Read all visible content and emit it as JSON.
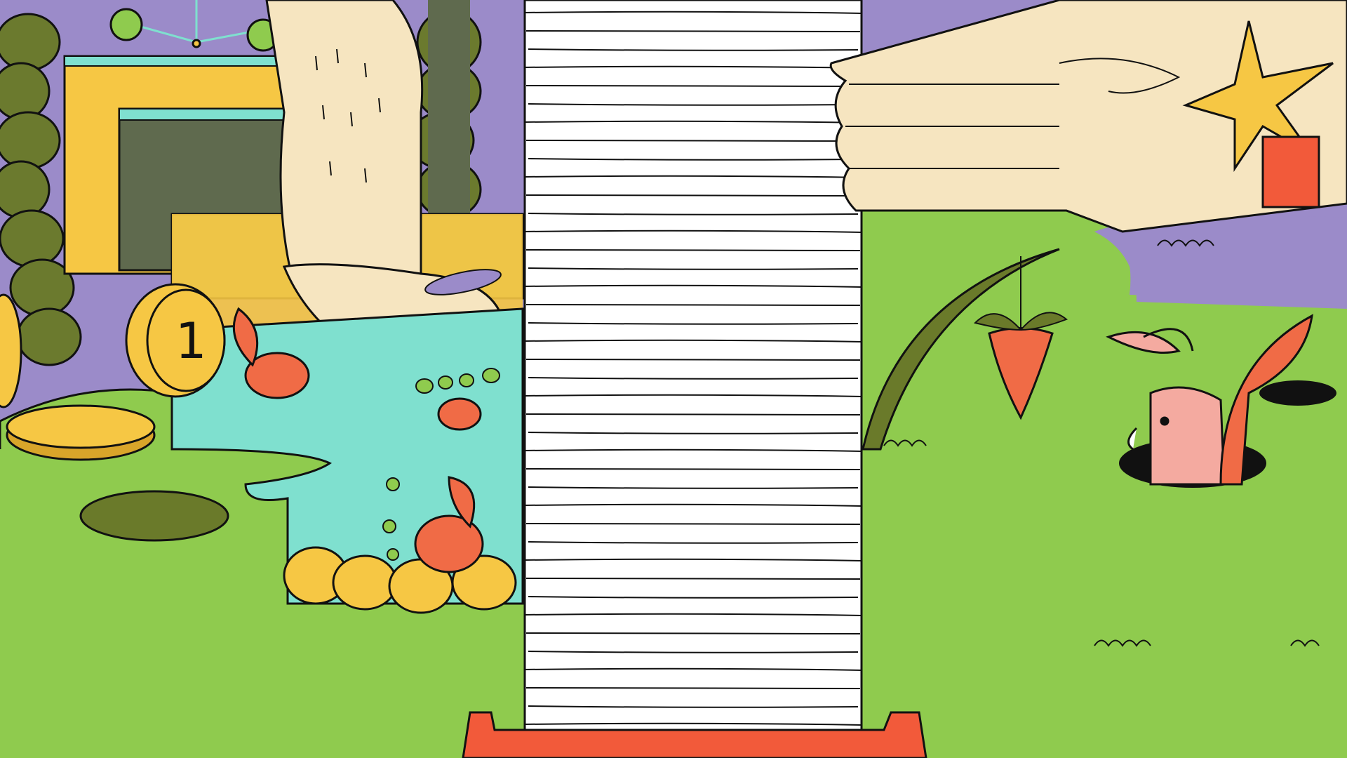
{
  "illustration": {
    "coin_glyph": "1",
    "colors": {
      "sky": "#9b8bc9",
      "grass": "#8fcb4e",
      "grass_dark": "#6a7a2a",
      "bush": "#6b7a2e",
      "skin": "#f6e5c0",
      "paper": "#ffffff",
      "water": "#7fe0cf",
      "fish": "#f06b46",
      "coin": "#f6c744",
      "bunny": "#f4aaa0",
      "tray": "#f25a3a",
      "accent_star": "#f6c744",
      "outline": "#111111"
    },
    "icons": [
      "coin-icon",
      "fish-icon",
      "carrot-icon",
      "bunny-icon",
      "star-icon",
      "paper-stack-icon",
      "hand-icon",
      "foot-icon"
    ]
  }
}
